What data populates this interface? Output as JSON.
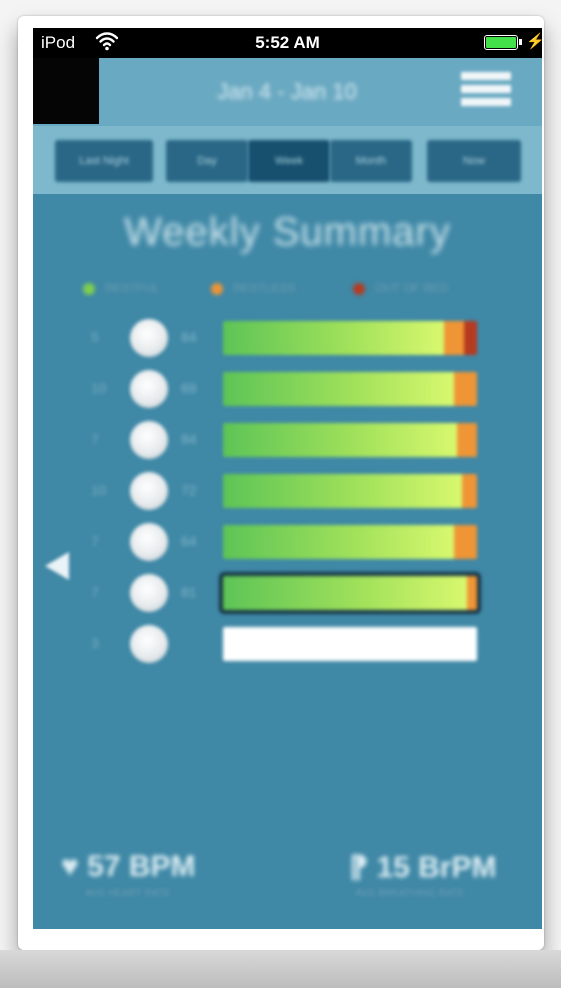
{
  "statusbar": {
    "carrier": "iPod",
    "time": "5:52 AM",
    "wifi_icon": "wifi-icon",
    "battery_icon": "battery-charging-icon"
  },
  "nav": {
    "title": "Jan 4 - Jan 10",
    "menu_icon": "hamburger-menu-icon"
  },
  "segments": [
    {
      "label": "Last Night",
      "active": false
    },
    {
      "label": "Day",
      "active": false
    },
    {
      "label": "Week",
      "active": true
    },
    {
      "label": "Month",
      "active": false
    },
    {
      "label": "Now",
      "active": false
    }
  ],
  "summary": {
    "title": "Weekly Summary",
    "legend": [
      {
        "label": "RESTFUL",
        "color": "#7ed04e"
      },
      {
        "label": "RESTLESS",
        "color": "#ef9535"
      },
      {
        "label": "OUT OF BED",
        "color": "#b63a1f"
      }
    ],
    "rows": [
      {
        "count": "5",
        "score": "84",
        "restful": 0.87,
        "restless": 0.08,
        "outofbed": 0.05,
        "selected": false,
        "empty": false
      },
      {
        "count": "10",
        "score": "69",
        "restful": 0.91,
        "restless": 0.09,
        "outofbed": 0,
        "selected": false,
        "empty": false
      },
      {
        "count": "7",
        "score": "84",
        "restful": 0.92,
        "restless": 0.08,
        "outofbed": 0,
        "selected": false,
        "empty": false
      },
      {
        "count": "10",
        "score": "72",
        "restful": 0.94,
        "restless": 0.06,
        "outofbed": 0,
        "selected": false,
        "empty": false
      },
      {
        "count": "7",
        "score": "64",
        "restful": 0.91,
        "restless": 0.09,
        "outofbed": 0,
        "selected": false,
        "empty": false
      },
      {
        "count": "7",
        "score": "81",
        "restful": 0.96,
        "restless": 0.04,
        "outofbed": 0,
        "selected": true,
        "empty": false
      },
      {
        "count": "3",
        "score": "",
        "restful": 0,
        "restless": 0,
        "outofbed": 0,
        "selected": false,
        "empty": true
      }
    ]
  },
  "stats": {
    "heart_rate": "57 BPM",
    "heart_rate_label": "AVG HEART RATE",
    "heart_icon": "heart-icon",
    "breathing_rate": "15 BrPM",
    "breathing_rate_label": "AVG BREATHING RATE",
    "breathing_icon": "lungs-icon"
  },
  "prev_icon": "left-arrow-icon"
}
